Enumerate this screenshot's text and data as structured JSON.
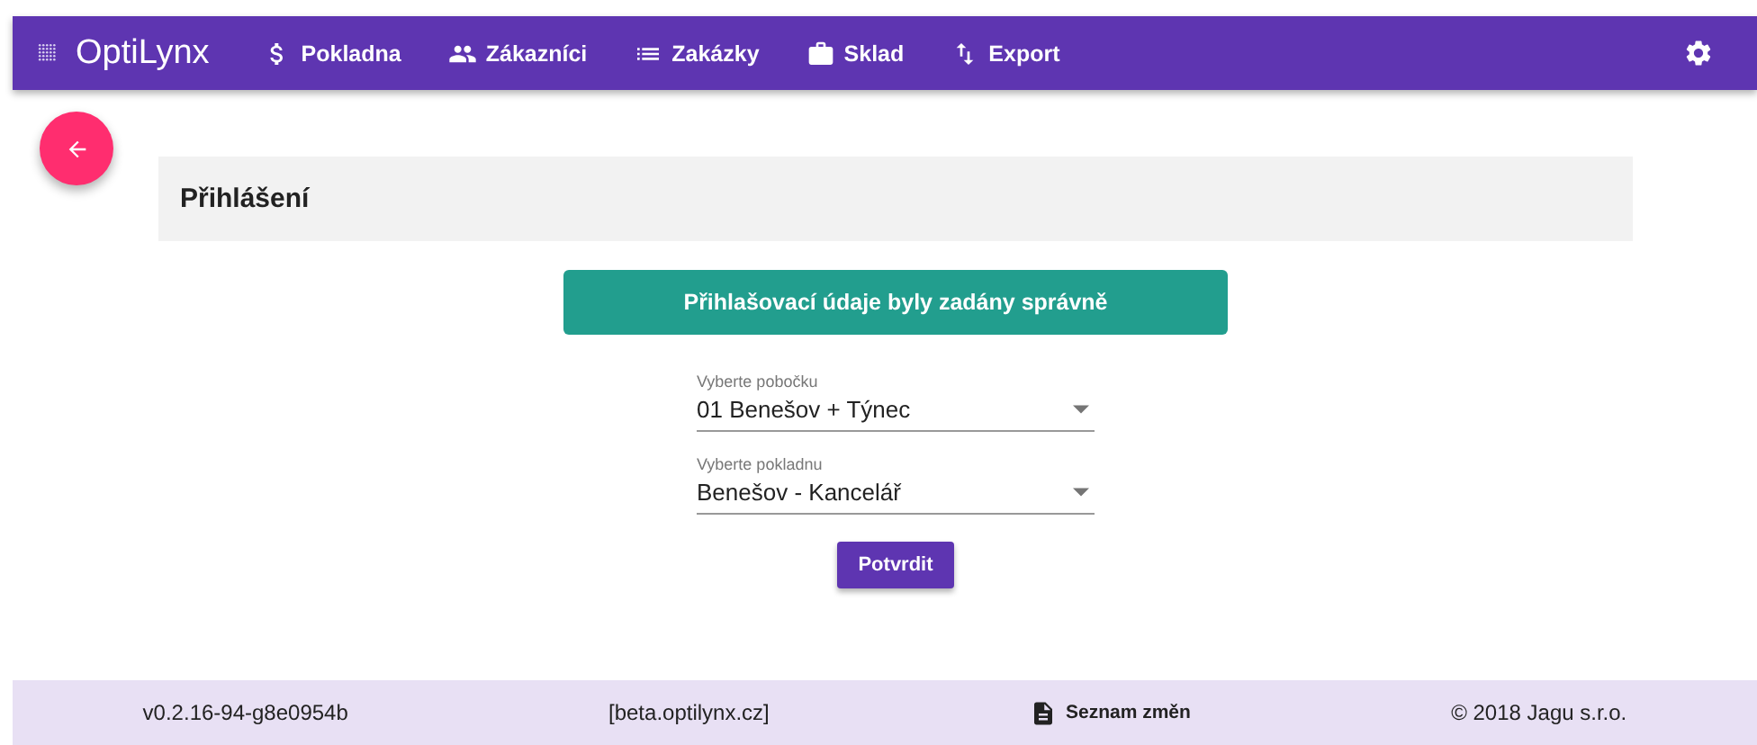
{
  "app_bar": {
    "brand": "OptiLynx",
    "nav": [
      {
        "label": "Pokladna"
      },
      {
        "label": "Zákazníci"
      },
      {
        "label": "Zakázky"
      },
      {
        "label": "Sklad"
      },
      {
        "label": "Export"
      }
    ]
  },
  "page_title": "Přihlášení",
  "alert": "Přihlašovací údaje byly zadány správně",
  "selects": [
    {
      "label": "Vyberte pobočku",
      "value": "01 Benešov + Týnec"
    },
    {
      "label": "Vyberte pokladnu",
      "value": "Benešov - Kancelář"
    }
  ],
  "confirm_button": "Potvrdit",
  "footer": {
    "version": "v0.2.16-94-g8e0954b",
    "host": "[beta.optilynx.cz]",
    "changelog": "Seznam změn",
    "copyright": "© 2018 Jagu s.r.o."
  }
}
